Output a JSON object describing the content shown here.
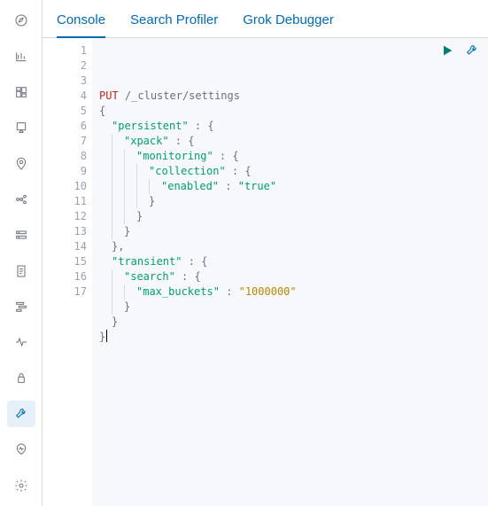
{
  "tabs": {
    "console": "Console",
    "profiler": "Search Profiler",
    "grok": "Grok Debugger"
  },
  "sidebar": {
    "items": [
      {
        "name": "discover"
      },
      {
        "name": "visualize"
      },
      {
        "name": "dashboard"
      },
      {
        "name": "canvas"
      },
      {
        "name": "maps"
      },
      {
        "name": "ml"
      },
      {
        "name": "infrastructure"
      },
      {
        "name": "logs"
      },
      {
        "name": "apm"
      },
      {
        "name": "uptime"
      },
      {
        "name": "siem"
      },
      {
        "name": "devtools"
      },
      {
        "name": "stackmon"
      },
      {
        "name": "management"
      }
    ]
  },
  "editor": {
    "lines": [
      {
        "num": "1",
        "fold": "",
        "indent": 0,
        "tokens": [
          [
            "method",
            "PUT"
          ],
          [
            "plain",
            " "
          ],
          [
            "path",
            "/_cluster/settings"
          ]
        ]
      },
      {
        "num": "2",
        "fold": "▾",
        "indent": 0,
        "tokens": [
          [
            "punc",
            "{"
          ]
        ]
      },
      {
        "num": "3",
        "fold": "▾",
        "indent": 1,
        "tokens": [
          [
            "key",
            "\"persistent\""
          ],
          [
            "punc",
            " : {"
          ]
        ]
      },
      {
        "num": "4",
        "fold": "▾",
        "indent": 2,
        "tokens": [
          [
            "key",
            "\"xpack\""
          ],
          [
            "punc",
            " : {"
          ]
        ]
      },
      {
        "num": "5",
        "fold": "▾",
        "indent": 3,
        "tokens": [
          [
            "key",
            "\"monitoring\""
          ],
          [
            "punc",
            " : {"
          ]
        ]
      },
      {
        "num": "6",
        "fold": "▾",
        "indent": 4,
        "tokens": [
          [
            "key",
            "\"collection\""
          ],
          [
            "punc",
            " : {"
          ]
        ]
      },
      {
        "num": "7",
        "fold": "",
        "indent": 5,
        "tokens": [
          [
            "key",
            "\"enabled\""
          ],
          [
            "punc",
            " : "
          ],
          [
            "string2",
            "\"true\""
          ]
        ]
      },
      {
        "num": "8",
        "fold": "▴",
        "indent": 4,
        "tokens": [
          [
            "punc",
            "}"
          ]
        ]
      },
      {
        "num": "9",
        "fold": "▴",
        "indent": 3,
        "tokens": [
          [
            "punc",
            "}"
          ]
        ]
      },
      {
        "num": "10",
        "fold": "▴",
        "indent": 2,
        "tokens": [
          [
            "punc",
            "}"
          ]
        ]
      },
      {
        "num": "11",
        "fold": "▴",
        "indent": 1,
        "tokens": [
          [
            "punc",
            "},"
          ]
        ]
      },
      {
        "num": "12",
        "fold": "▾",
        "indent": 1,
        "tokens": [
          [
            "key",
            "\"transient\""
          ],
          [
            "punc",
            " : {"
          ]
        ]
      },
      {
        "num": "13",
        "fold": "▾",
        "indent": 2,
        "tokens": [
          [
            "key",
            "\"search\""
          ],
          [
            "punc",
            " : {"
          ]
        ]
      },
      {
        "num": "14",
        "fold": "",
        "indent": 3,
        "tokens": [
          [
            "key",
            "\"max_buckets\""
          ],
          [
            "punc",
            " : "
          ],
          [
            "string",
            "\"1000000\""
          ]
        ]
      },
      {
        "num": "15",
        "fold": "▴",
        "indent": 2,
        "tokens": [
          [
            "punc",
            "}"
          ]
        ]
      },
      {
        "num": "16",
        "fold": "▴",
        "indent": 1,
        "tokens": [
          [
            "punc",
            "}"
          ]
        ]
      },
      {
        "num": "17",
        "fold": "▴",
        "indent": 0,
        "tokens": [
          [
            "punc",
            "}"
          ]
        ],
        "cursor": true
      }
    ]
  }
}
